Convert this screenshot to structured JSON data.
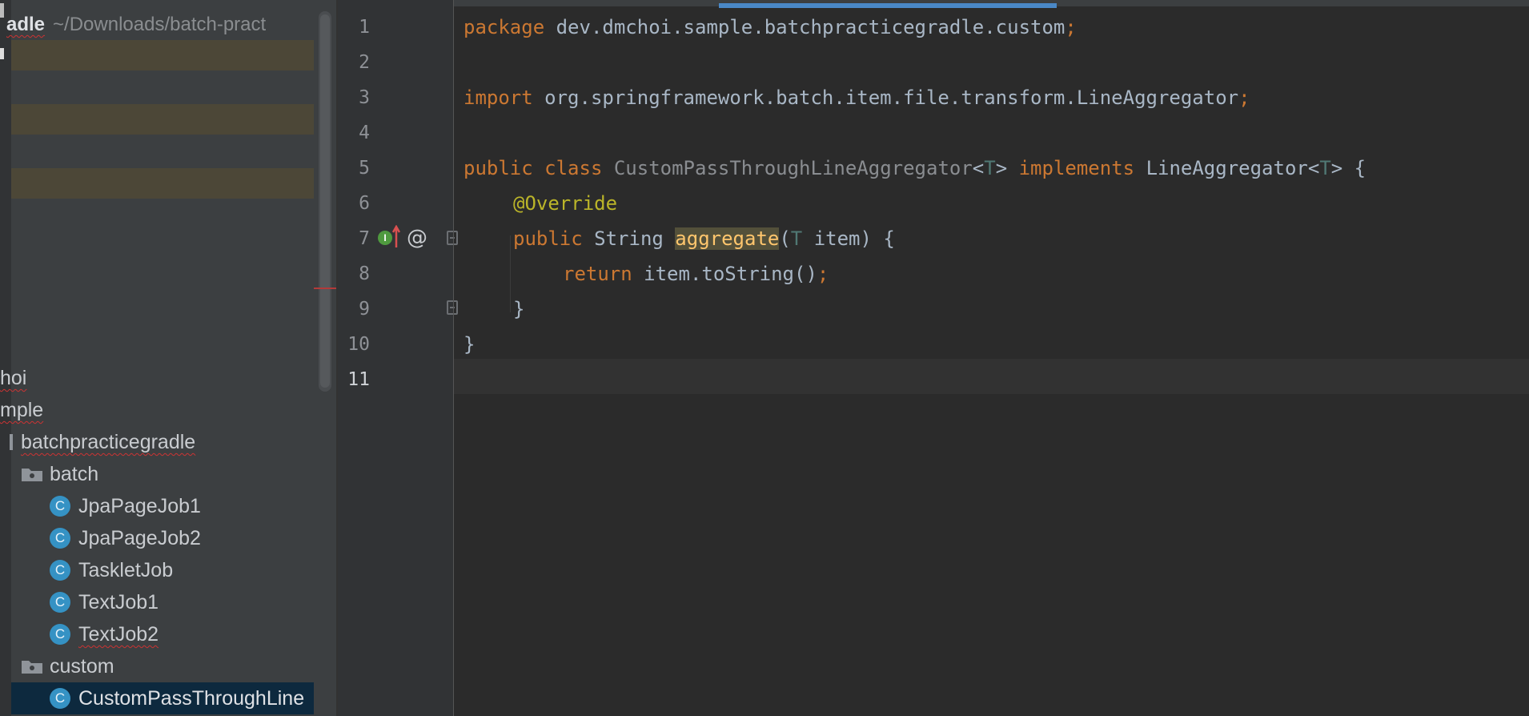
{
  "project": {
    "name": "adle",
    "path": "~/Downloads/batch-pract"
  },
  "tree": {
    "partial_nodes": [
      "hoi",
      "mple"
    ],
    "root_package": "batchpracticegradle",
    "folders": [
      {
        "name": "batch",
        "classes": [
          {
            "name": "JpaPageJob1",
            "icon": "C"
          },
          {
            "name": "JpaPageJob2",
            "icon": "C"
          },
          {
            "name": "TaskletJob",
            "icon": "C"
          },
          {
            "name": "TextJob1",
            "icon": "C"
          },
          {
            "name": "TextJob2",
            "icon": "C"
          }
        ]
      },
      {
        "name": "custom",
        "classes": [
          {
            "name": "CustomPassThroughLine",
            "icon": "C"
          }
        ]
      }
    ]
  },
  "editor": {
    "line_numbers": [
      "1",
      "2",
      "3",
      "4",
      "5",
      "6",
      "7",
      "8",
      "9",
      "10",
      "11"
    ],
    "current_line": "11",
    "gutter_at_symbol": "@",
    "gutter_impl_letter": "I",
    "code": {
      "l1": {
        "kw": "package",
        "rest": " dev.dmchoi.sample.batchpracticegradle.custom",
        "semi": ";"
      },
      "l3": {
        "kw": "import",
        "rest": " org.springframework.batch.item.file.transform.LineAggregator",
        "semi": ";"
      },
      "l5": {
        "kw1": "public",
        "kw2": "class",
        "cls": "CustomPassThroughLineAggregator",
        "lt1": "<",
        "t1": "T",
        "gt1": ">",
        "impl": "implements",
        "iface": "LineAggregator",
        "lt2": "<",
        "t2": "T",
        "gt2": ">",
        "brace": " {"
      },
      "l6": {
        "annotation": "@Override"
      },
      "l7": {
        "kw": "public",
        "type": " String ",
        "method": "aggregate",
        "paren": "(",
        "tparam": "T",
        "param": " item) {"
      },
      "l8": {
        "kw": "return",
        "expr": " item.toString()",
        "semi": ";"
      },
      "l9": {
        "brace": "}"
      },
      "l10": {
        "brace": "}"
      }
    }
  },
  "colors": {
    "keyword": "#cc7832",
    "annotation": "#bbb529",
    "method_highlight": "#ffc66d",
    "type_param": "#507874",
    "default_text": "#a9b7c6",
    "selection": "#0d293e",
    "class_icon": "#3592c4"
  }
}
